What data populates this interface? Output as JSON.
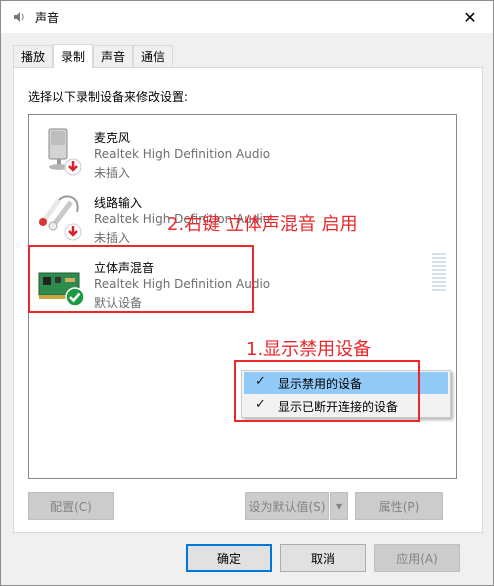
{
  "window": {
    "title": "声音",
    "close_glyph": "✕"
  },
  "tabs": [
    {
      "label": "播放"
    },
    {
      "label": "录制"
    },
    {
      "label": "声音"
    },
    {
      "label": "通信"
    }
  ],
  "instruction": "选择以下录制设备来修改设置:",
  "devices": [
    {
      "name": "麦克风",
      "desc": "Realtek High Definition Audio",
      "status": "未插入",
      "icon": "microphone-icon",
      "badge": "unplugged"
    },
    {
      "name": "线路输入",
      "desc": "Realtek High Definition Audio",
      "status": "未插入",
      "icon": "line-in-icon",
      "badge": "unplugged"
    },
    {
      "name": "立体声混音",
      "desc": "Realtek High Definition Audio",
      "status": "默认设备",
      "icon": "sound-card-icon",
      "badge": "default"
    }
  ],
  "annotations": {
    "step2": "2.右键 立体声混音 启用",
    "step1": "1.显示禁用设备"
  },
  "context_menu": [
    {
      "label": "显示禁用的设备",
      "checked": true,
      "highlighted": true
    },
    {
      "label": "显示已断开连接的设备",
      "checked": true,
      "highlighted": false
    }
  ],
  "buttons": {
    "configure": "配置(C)",
    "set_default": "设为默认值(S)",
    "properties": "属性(P)",
    "ok": "确定",
    "cancel": "取消",
    "apply": "应用(A)"
  },
  "colors": {
    "annotation_red": "#e8282b",
    "highlight": "#91c9f7",
    "accent": "#0078d7"
  }
}
